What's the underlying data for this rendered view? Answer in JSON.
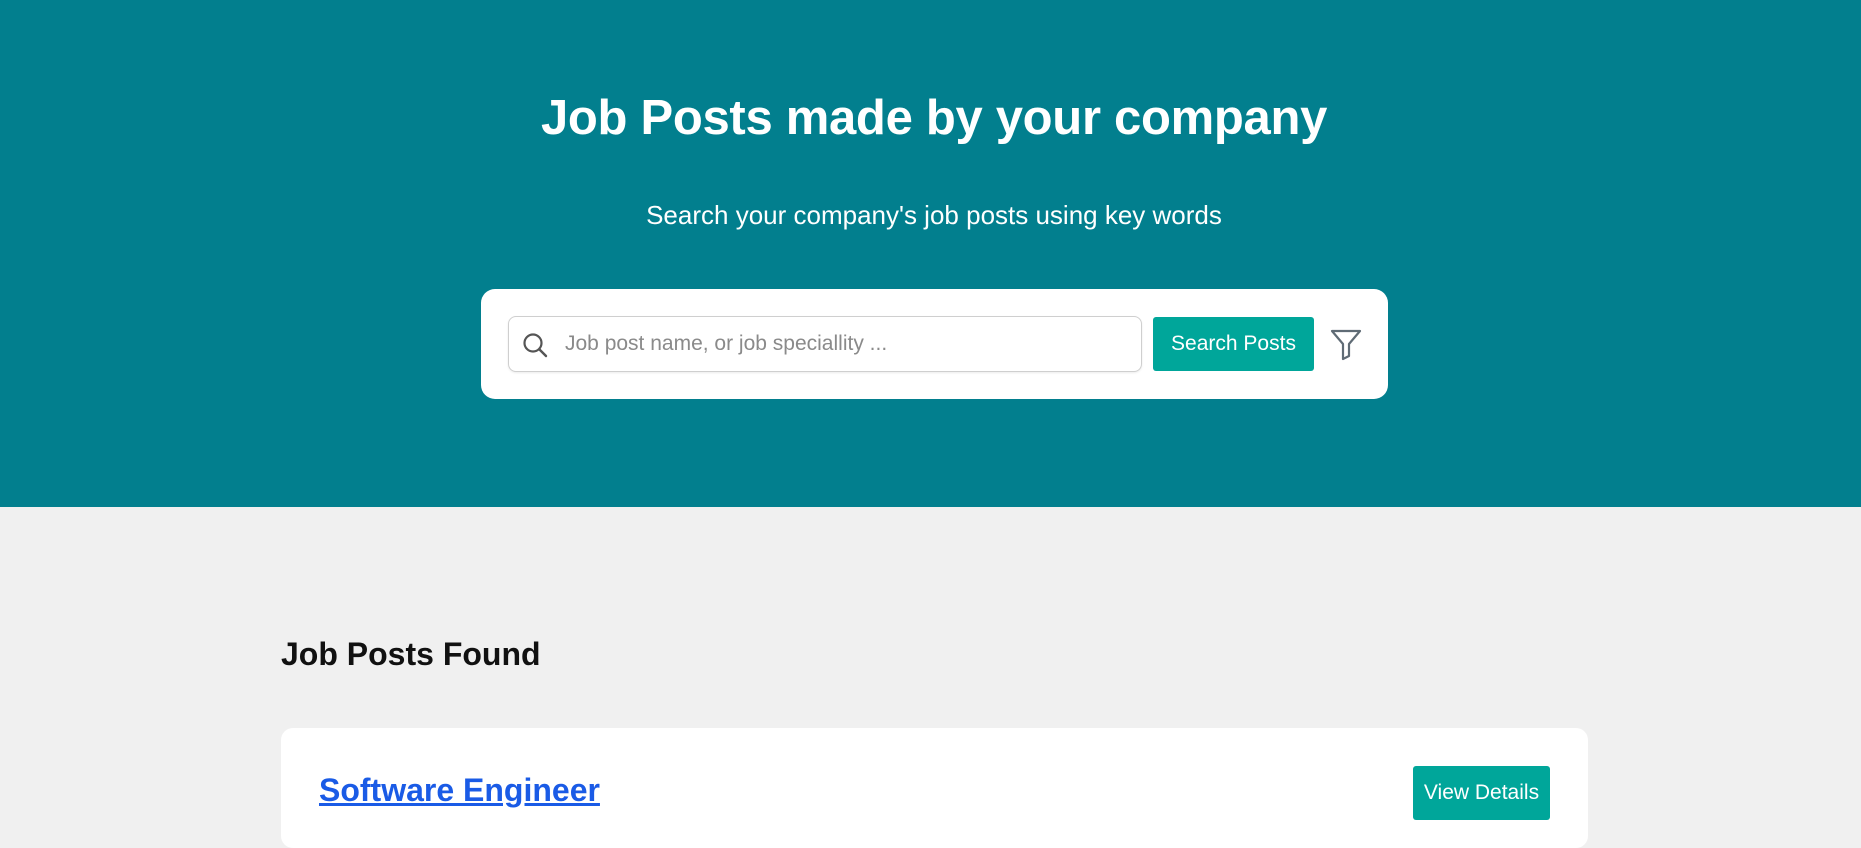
{
  "hero": {
    "title": "Job Posts made by your company",
    "subtitle": "Search your company's job posts using key words",
    "background_color": "#027f8e"
  },
  "search": {
    "placeholder": "Job post name, or job speciallity ...",
    "value": "",
    "button_label": "Search Posts",
    "icon": "search-icon",
    "filter_icon": "filter-icon",
    "button_color": "#00a69a"
  },
  "results": {
    "title": "Job Posts Found",
    "items": [
      {
        "title": "Software Engineer",
        "action_label": "View Details"
      }
    ]
  },
  "colors": {
    "accent": "#00a69a",
    "link": "#1a5be6",
    "page_background": "#f0f0f0"
  }
}
